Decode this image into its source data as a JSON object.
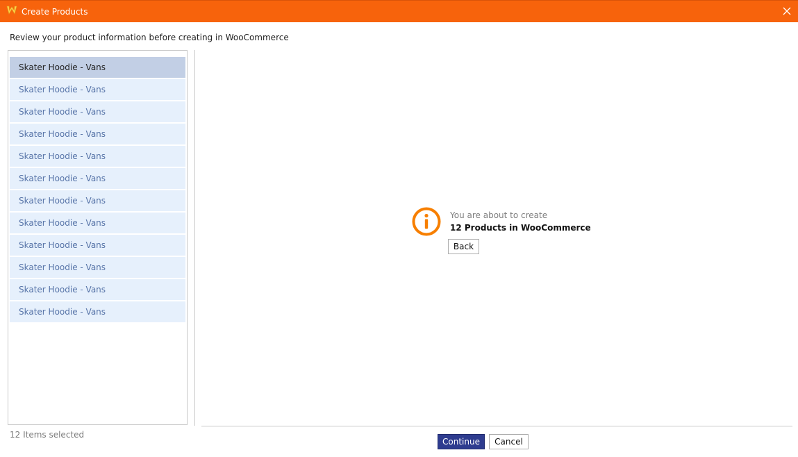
{
  "window": {
    "title": "Create Products"
  },
  "header": {
    "subtitle": "Review your product information before creating in WooCommerce"
  },
  "products": [
    {
      "label": "Skater Hoodie - Vans",
      "selected": true
    },
    {
      "label": "Skater Hoodie - Vans",
      "selected": false
    },
    {
      "label": "Skater Hoodie - Vans",
      "selected": false
    },
    {
      "label": "Skater Hoodie - Vans",
      "selected": false
    },
    {
      "label": "Skater Hoodie - Vans",
      "selected": false
    },
    {
      "label": "Skater Hoodie - Vans",
      "selected": false
    },
    {
      "label": "Skater Hoodie - Vans",
      "selected": false
    },
    {
      "label": "Skater Hoodie - Vans",
      "selected": false
    },
    {
      "label": "Skater Hoodie - Vans",
      "selected": false
    },
    {
      "label": "Skater Hoodie - Vans",
      "selected": false
    },
    {
      "label": "Skater Hoodie - Vans",
      "selected": false
    },
    {
      "label": "Skater Hoodie - Vans",
      "selected": false
    }
  ],
  "status": {
    "selection_text": "12 Items selected"
  },
  "info": {
    "line1": "You are about to create",
    "line2": "12 Products in WooCommerce",
    "back_label": "Back"
  },
  "footer": {
    "continue_label": "Continue",
    "cancel_label": "Cancel"
  },
  "icons": {
    "app": "woocommerce-w-icon",
    "close": "close-icon",
    "info": "info-circle-icon"
  },
  "colors": {
    "accent": "#f7630c",
    "list_bg": "#e6f0fc",
    "list_selected_bg": "#c2cfe5",
    "list_text": "#5774a8",
    "primary_button": "#2e3c8f"
  }
}
